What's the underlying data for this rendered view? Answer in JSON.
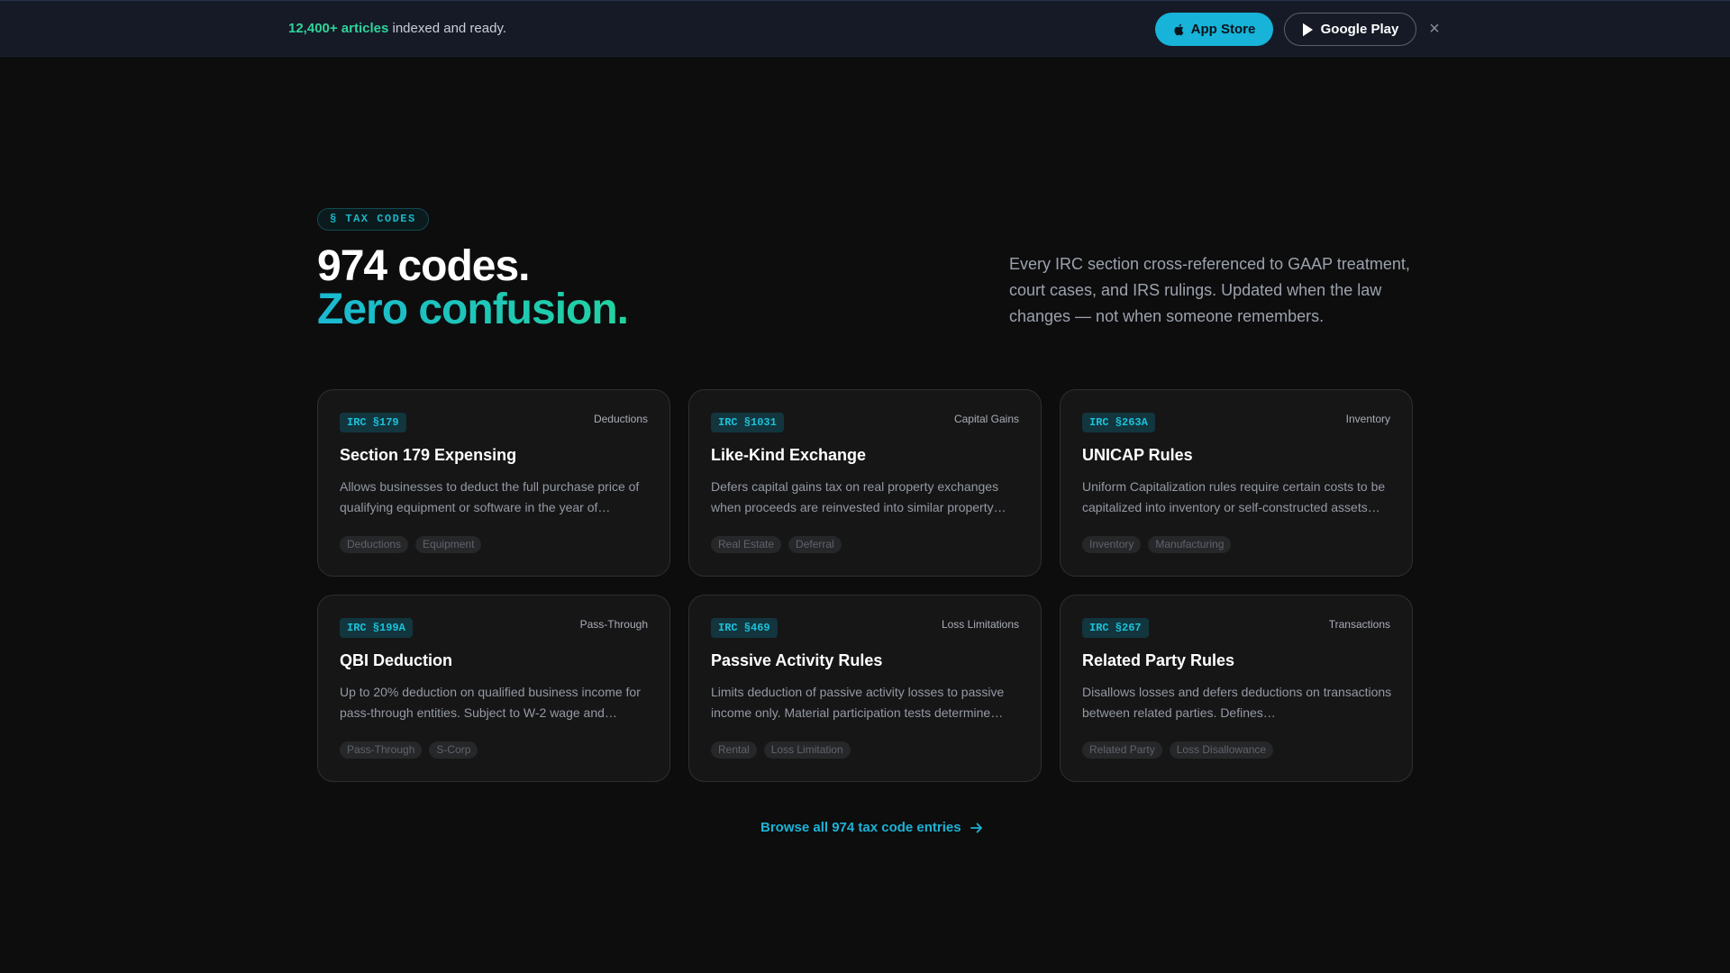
{
  "banner": {
    "highlight": "12,400+ articles",
    "text": " indexed and ready.",
    "app_store_label": "App Store",
    "google_play_label": "Google Play",
    "close_symbol": "×",
    "icons": {
      "app_store": "apple-icon",
      "google_play": "play-icon",
      "close": "close-icon"
    }
  },
  "hero": {
    "badge": "§ TAX CODES",
    "headline_1": "974 codes.",
    "headline_2": "Zero confusion.",
    "lede": "Every IRC section cross-referenced to GAAP treatment, court cases, and IRS rulings. Updated when the law changes — not when someone remembers."
  },
  "cards": [
    {
      "code": "IRC §179",
      "category": "Deductions",
      "title": "Section 179 Expensing",
      "description": "Allows businesses to deduct the full purchase price of qualifying equipment or software in the year of…",
      "tags": [
        "Deductions",
        "Equipment"
      ]
    },
    {
      "code": "IRC §1031",
      "category": "Capital Gains",
      "title": "Like-Kind Exchange",
      "description": "Defers capital gains tax on real property exchanges when proceeds are reinvested into similar property…",
      "tags": [
        "Real Estate",
        "Deferral"
      ]
    },
    {
      "code": "IRC §263A",
      "category": "Inventory",
      "title": "UNICAP Rules",
      "description": "Uniform Capitalization rules require certain costs to be capitalized into inventory or self-constructed assets…",
      "tags": [
        "Inventory",
        "Manufacturing"
      ]
    },
    {
      "code": "IRC §199A",
      "category": "Pass-Through",
      "title": "QBI Deduction",
      "description": "Up to 20% deduction on qualified business income for pass-through entities. Subject to W-2 wage and…",
      "tags": [
        "Pass-Through",
        "S-Corp"
      ]
    },
    {
      "code": "IRC §469",
      "category": "Loss Limitations",
      "title": "Passive Activity Rules",
      "description": "Limits deduction of passive activity losses to passive income only. Material participation tests determine…",
      "tags": [
        "Rental",
        "Loss Limitation"
      ]
    },
    {
      "code": "IRC §267",
      "category": "Transactions",
      "title": "Related Party Rules",
      "description": "Disallows losses and defers deductions on transactions between related parties. Defines…",
      "tags": [
        "Related Party",
        "Loss Disallowance"
      ]
    }
  ],
  "browse": {
    "label": "Browse all 974 tax code entries",
    "icon": "arrow-right-icon"
  },
  "colors": {
    "accent": "#17b3d8",
    "green": "#22d3a0",
    "background": "#0d0d0e"
  }
}
